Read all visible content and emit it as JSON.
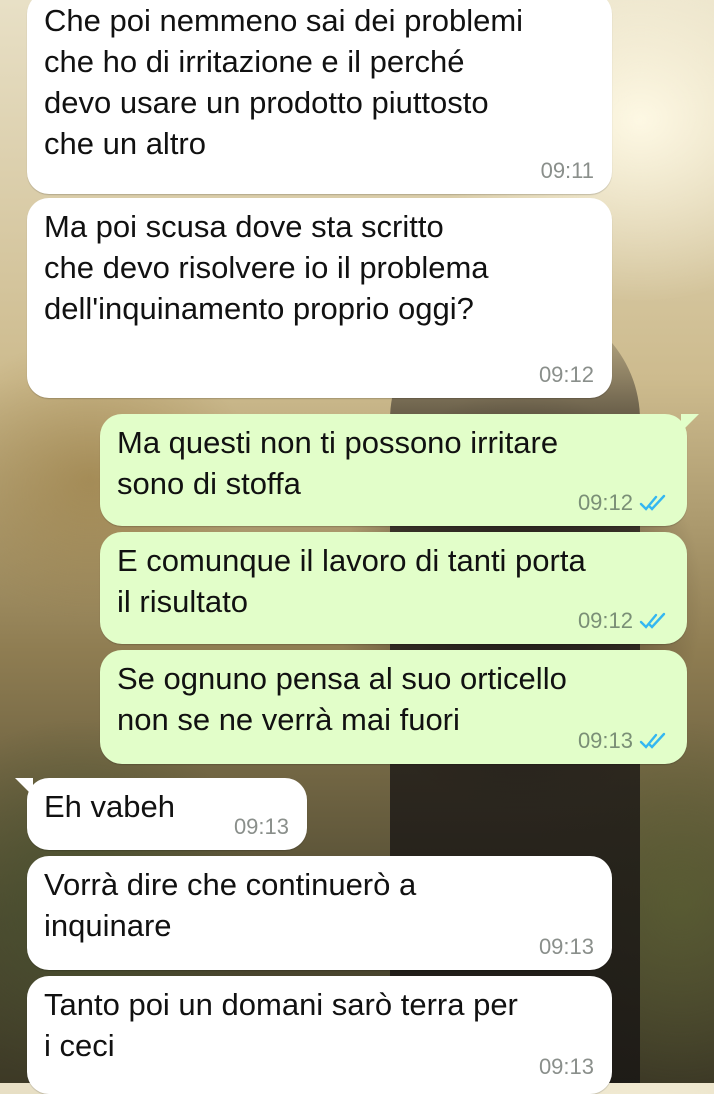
{
  "chat": {
    "messages": [
      {
        "direction": "incoming",
        "text": "Che poi nemmeno sai dei problemi\nche ho di irritazione e il perché\ndevo usare un prodotto piuttosto\nche un altro",
        "time": "09:11"
      },
      {
        "direction": "incoming",
        "text": "Ma poi scusa dove sta scritto\nche devo risolvere io il problema\ndell'inquinamento proprio oggi?",
        "time": "09:12"
      },
      {
        "direction": "outgoing",
        "text": "Ma questi non ti possono irritare\nsono di stoffa",
        "time": "09:12",
        "status": "read"
      },
      {
        "direction": "outgoing",
        "text": "E comunque il lavoro di tanti porta\nil risultato",
        "time": "09:12",
        "status": "read"
      },
      {
        "direction": "outgoing",
        "text": "Se ognuno pensa al suo orticello\nnon se ne verrà mai fuori",
        "time": "09:13",
        "status": "read"
      },
      {
        "direction": "incoming",
        "text": "Eh vabeh",
        "time": "09:13"
      },
      {
        "direction": "incoming",
        "text": "Vorrà dire che continuerò a\ninquinare",
        "time": "09:13"
      },
      {
        "direction": "incoming",
        "text": "Tanto poi un domani sarò terra per\ni ceci",
        "time": "09:13"
      }
    ]
  },
  "colors": {
    "incoming_bubble": "#ffffff",
    "outgoing_bubble": "#e2fec9",
    "read_ticks": "#34b7f1"
  },
  "icons": {
    "read_status": "double-check-icon"
  }
}
